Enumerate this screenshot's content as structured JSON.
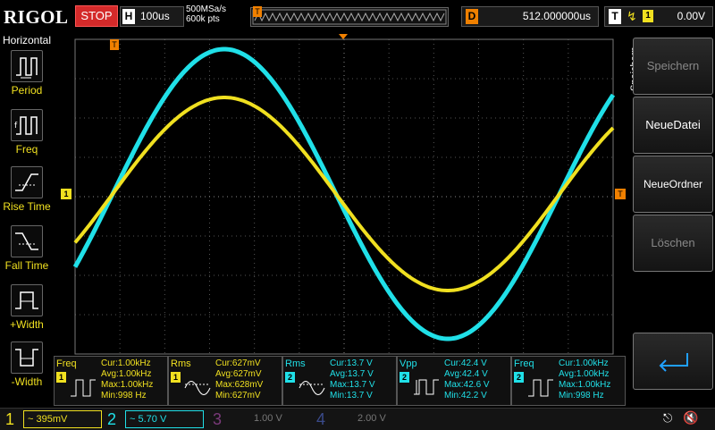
{
  "brand": "RIGOL",
  "run_state": "STOP",
  "timebase": {
    "label": "H",
    "value": "100us"
  },
  "sample": {
    "rate": "500MSa/s",
    "depth": "600k pts"
  },
  "memory_strip": {
    "marker": "T"
  },
  "delay": {
    "label": "D",
    "value": "512.000000us"
  },
  "trigger": {
    "label": "T",
    "edge": "rising-edge-icon",
    "source": "1",
    "level": "0.00V"
  },
  "left_panel": {
    "title": "Horizontal",
    "items": [
      {
        "label": "Period",
        "icon": "period-icon"
      },
      {
        "label": "Freq",
        "icon": "freq-icon"
      },
      {
        "label": "Rise Time",
        "icon": "rise-time-icon"
      },
      {
        "label": "Fall Time",
        "icon": "fall-time-icon"
      },
      {
        "label": "+Width",
        "icon": "positive-width-icon"
      },
      {
        "label": "-Width",
        "icon": "negative-width-icon"
      }
    ]
  },
  "right_panel": {
    "title": "Speichern",
    "buttons": [
      {
        "label": "Speichern",
        "enabled": false
      },
      {
        "label": "NeueDatei",
        "enabled": true
      },
      {
        "label": "NeueOrdner",
        "enabled": true
      },
      {
        "label": "Löschen",
        "enabled": false
      },
      {
        "label": "",
        "icon": "return-icon",
        "enabled": true
      }
    ]
  },
  "markers": {
    "trigger_pos": "T",
    "ch1_ground": "1",
    "trig_level": "T"
  },
  "measurements": [
    {
      "name": "Freq",
      "ch": "1",
      "lines": [
        "Cur:1.00kHz",
        "Avg:1.00kHz",
        "Max:1.00kHz",
        "Min:998 Hz"
      ]
    },
    {
      "name": "Rms",
      "ch": "1",
      "lines": [
        "Cur:627mV",
        "Avg:627mV",
        "Max:628mV",
        "Min:627mV"
      ]
    },
    {
      "name": "Rms",
      "ch": "2",
      "lines": [
        "Cur:13.7 V",
        "Avg:13.7 V",
        "Max:13.7 V",
        "Min:13.7 V"
      ]
    },
    {
      "name": "Vpp",
      "ch": "2",
      "lines": [
        "Cur:42.4 V",
        "Avg:42.4 V",
        "Max:42.6 V",
        "Min:42.2 V"
      ]
    },
    {
      "name": "Freq",
      "ch": "2",
      "lines": [
        "Cur:1.00kHz",
        "Avg:1.00kHz",
        "Max:1.00kHz",
        "Min:998 Hz"
      ]
    }
  ],
  "channels": [
    {
      "num": "1",
      "scale": "395mV",
      "active": true
    },
    {
      "num": "2",
      "scale": "5.70 V",
      "active": true
    },
    {
      "num": "3",
      "scale": "1.00 V",
      "active": false
    },
    {
      "num": "4",
      "scale": "2.00 V",
      "active": false
    }
  ],
  "colors": {
    "ch1": "#f0e020",
    "ch2": "#20e0e8",
    "ch3": "#d040d0",
    "ch4": "#3060ff",
    "stop": "#d42a2a",
    "accent": "#f08000"
  },
  "status_icons": [
    "usb-icon",
    "speaker-muted-icon"
  ]
}
